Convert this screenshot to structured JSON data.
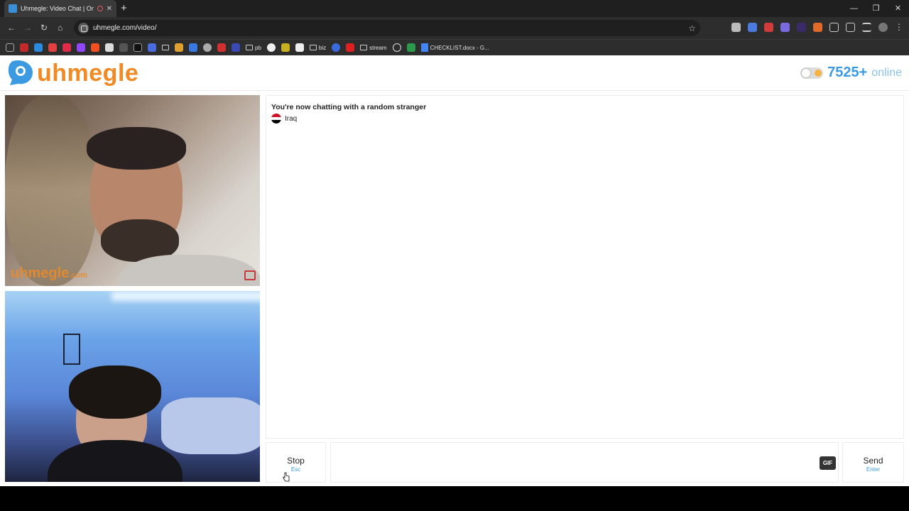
{
  "browser": {
    "tab_title": "Uhmegle: Video Chat | Om",
    "url": "uhmegle.com/video/",
    "bookmarks": [
      {
        "label": "pb"
      },
      {
        "label": "biz"
      },
      {
        "label": "stream"
      },
      {
        "label": "CHECKLIST.docx - G..."
      }
    ]
  },
  "header": {
    "logo_text": "uhmegle",
    "online_count": "7525+",
    "online_label": "online"
  },
  "stranger_video": {
    "watermark": "uhmegle",
    "watermark_suffix": ".com"
  },
  "chat": {
    "status_message": "You're now chatting with a random stranger",
    "country": "Iraq"
  },
  "controls": {
    "stop_label": "Stop",
    "stop_hint": "Esc",
    "message_placeholder": "",
    "gif_label": "GIF",
    "send_label": "Send",
    "send_hint": "Enter"
  },
  "colors": {
    "brand_orange": "#f08a24",
    "brand_blue": "#3b9ae1"
  }
}
